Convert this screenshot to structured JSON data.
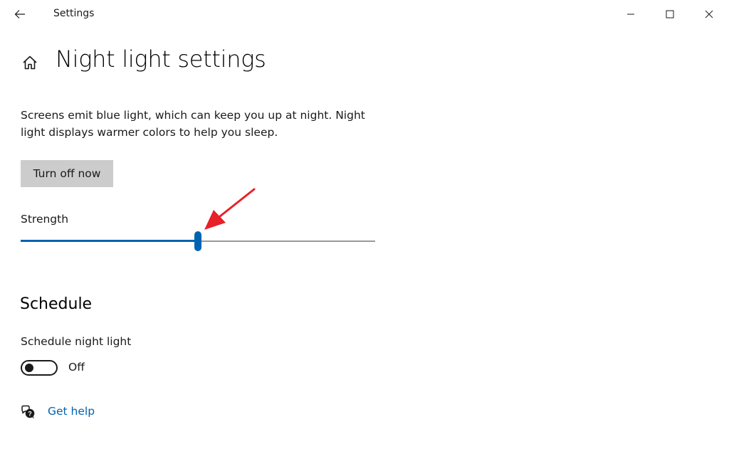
{
  "window": {
    "title": "Settings"
  },
  "header": {
    "title": "Night light settings"
  },
  "description": "Screens emit blue light, which can keep you up at night. Night light displays warmer colors to help you sleep.",
  "actions": {
    "turn_off_label": "Turn off now"
  },
  "strength": {
    "label": "Strength",
    "value_percent": 50
  },
  "schedule": {
    "heading": "Schedule",
    "label": "Schedule night light",
    "toggle_state": "Off",
    "toggle_on": false
  },
  "help": {
    "label": "Get help"
  },
  "icons": {
    "back": "back-arrow-icon",
    "home": "home-icon",
    "minimize": "minimize-icon",
    "maximize": "maximize-icon",
    "close": "close-icon",
    "help": "help-chat-icon",
    "annotation": "red-arrow-annotation"
  },
  "colors": {
    "accent": "#0063b1",
    "track": "#999999",
    "button_bg": "#cccccc",
    "annotation": "#e8202a",
    "text": "#1a1a1a"
  }
}
